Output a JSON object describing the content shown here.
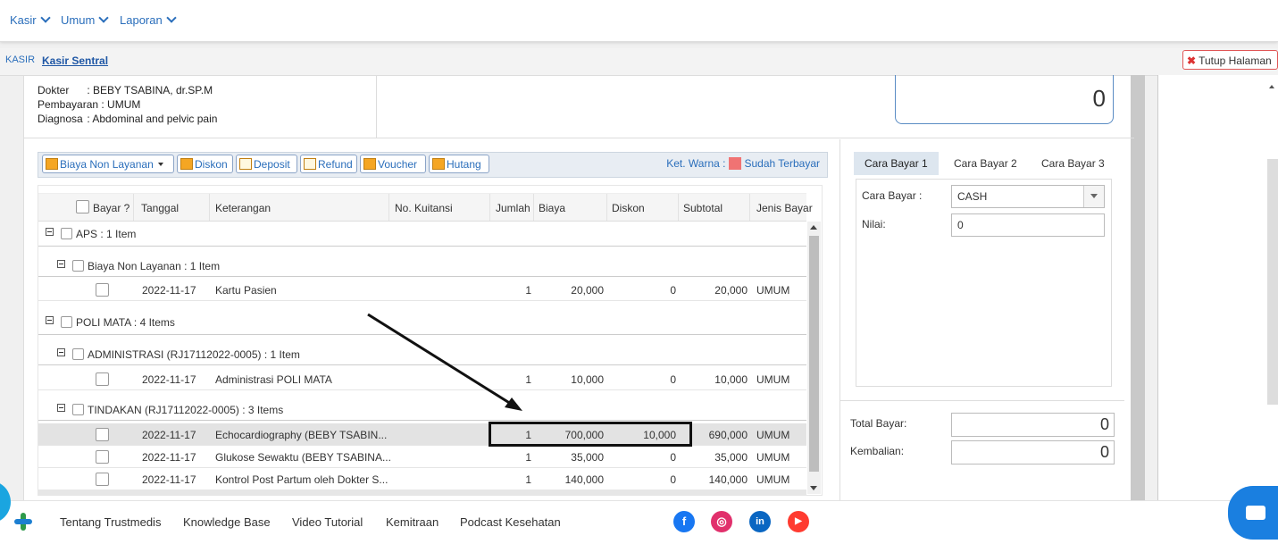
{
  "menu": {
    "items": [
      "Kasir",
      "Umum",
      "Laporan"
    ]
  },
  "tabbar": {
    "prefix": "KASIR",
    "active_tab": "Kasir Sentral",
    "close_label": "Tutup Halaman"
  },
  "patient": {
    "dokter_label": "Dokter",
    "dokter_value": ": BEBY TSABINA, dr.SP.M",
    "pembayaran_label": "Pembayaran",
    "pembayaran_value": ": UMUM",
    "diagnosa_label": "Diagnosa",
    "diagnosa_value": ": Abdominal and pelvic pain"
  },
  "top_total": "0",
  "toolbar": {
    "biaya_non_layanan": "Biaya Non Layanan",
    "diskon": "Diskon",
    "deposit": "Deposit",
    "refund": "Refund",
    "voucher": "Voucher",
    "hutang": "Hutang",
    "ket_warna": "Ket. Warna :",
    "sudah_terbayar": "Sudah Terbayar",
    "sudah_terbayar_color": "#f07373"
  },
  "table": {
    "columns": [
      "Bayar ?",
      "Tanggal",
      "Keterangan",
      "No. Kuitansi",
      "Jumlah",
      "Biaya",
      "Diskon",
      "Subtotal",
      "Jenis Bayar"
    ],
    "groups": {
      "aps": "APS : 1 Item",
      "biaya_non_layanan": "Biaya Non Layanan : 1 Item",
      "poli_mata": "POLI MATA : 4 Items",
      "administrasi": "ADMINISTRASI (RJ17112022-0005) : 1 Item",
      "tindakan": "TINDAKAN (RJ17112022-0005) : 3 Items"
    },
    "rows": [
      {
        "tanggal": "2022-11-17",
        "keterangan": "Kartu Pasien",
        "jumlah": "1",
        "biaya": "20,000",
        "diskon": "0",
        "subtotal": "20,000",
        "jenis": "UMUM"
      },
      {
        "tanggal": "2022-11-17",
        "keterangan": "Administrasi POLI MATA",
        "jumlah": "1",
        "biaya": "10,000",
        "diskon": "0",
        "subtotal": "10,000",
        "jenis": "UMUM"
      },
      {
        "tanggal": "2022-11-17",
        "keterangan": "Echocardiography (BEBY TSABIN...",
        "jumlah": "1",
        "biaya": "700,000",
        "diskon": "10,000",
        "subtotal": "690,000",
        "jenis": "UMUM"
      },
      {
        "tanggal": "2022-11-17",
        "keterangan": "Glukose Sewaktu (BEBY TSABINA...",
        "jumlah": "1",
        "biaya": "35,000",
        "diskon": "0",
        "subtotal": "35,000",
        "jenis": "UMUM"
      },
      {
        "tanggal": "2022-11-17",
        "keterangan": "Kontrol Post Partum oleh Dokter S...",
        "jumlah": "1",
        "biaya": "140,000",
        "diskon": "0",
        "subtotal": "140,000",
        "jenis": "UMUM"
      }
    ]
  },
  "payment": {
    "tabs": [
      "Cara Bayar 1",
      "Cara Bayar 2",
      "Cara Bayar 3"
    ],
    "cara_bayar_label": "Cara Bayar :",
    "cara_bayar_value": "CASH",
    "nilai_label": "Nilai:",
    "nilai_value": "0",
    "total_bayar_label": "Total Bayar:",
    "total_bayar_value": "0",
    "kembalian_label": "Kembalian:",
    "kembalian_value": "0"
  },
  "footer": {
    "links": [
      "Tentang Trustmedis",
      "Knowledge Base",
      "Video Tutorial",
      "Kemitraan",
      "Podcast Kesehatan"
    ],
    "social": [
      {
        "icon": "facebook-icon",
        "glyph": "f",
        "color": "#1877f2"
      },
      {
        "icon": "instagram-icon",
        "glyph": "◎",
        "color": "#e1306c"
      },
      {
        "icon": "linkedin-icon",
        "glyph": "in",
        "color": "#0a66c2"
      },
      {
        "icon": "youtube-icon",
        "glyph": "▶",
        "color": "#ff3b30"
      }
    ]
  }
}
